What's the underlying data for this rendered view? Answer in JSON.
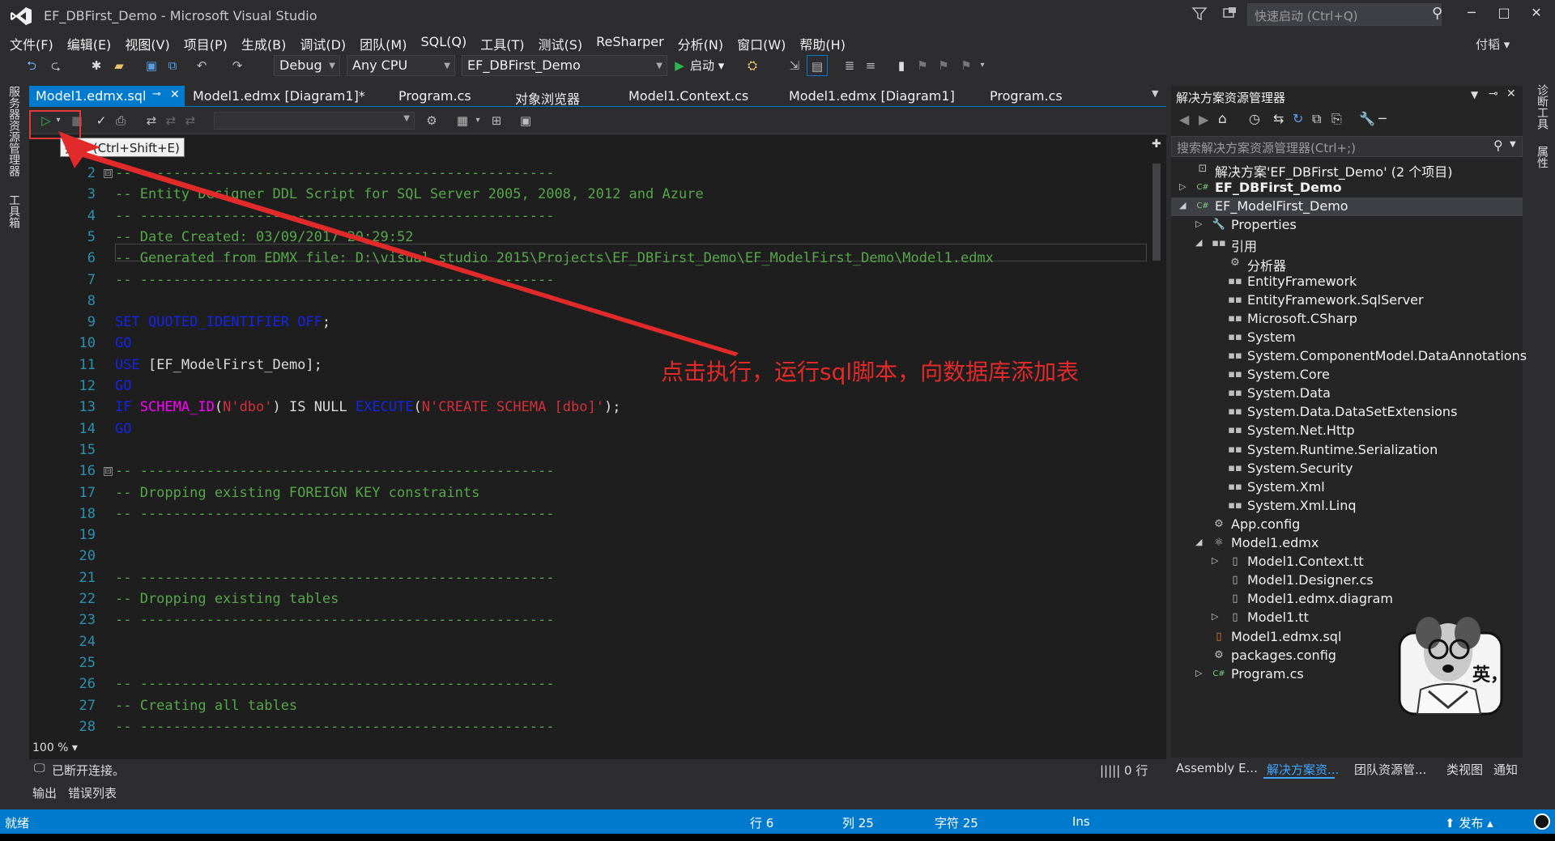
{
  "window": {
    "title": "EF_DBFirst_Demo - Microsoft Visual Studio",
    "quick_launch_placeholder": "快速启动 (Ctrl+Q)",
    "user": "付韬",
    "minimize": "─",
    "restore": "□",
    "close": "✕"
  },
  "menu": [
    "文件(F)",
    "编辑(E)",
    "视图(V)",
    "项目(P)",
    "生成(B)",
    "调试(D)",
    "团队(M)",
    "SQL(Q)",
    "工具(T)",
    "测试(S)",
    "ReSharper",
    "分析(N)",
    "窗口(W)",
    "帮助(H)"
  ],
  "toolbar": {
    "config": "Debug",
    "platform": "Any CPU",
    "project": "EF_DBFirst_Demo",
    "start_label": "启动"
  },
  "left_side_tabs": [
    "服务器资源管理器",
    "工具箱"
  ],
  "right_side_tabs": [
    "诊断工具",
    "属性"
  ],
  "tabs": [
    {
      "label": "Model1.edmx.sql",
      "pin": "⊸",
      "close": "✕"
    },
    {
      "label": "Model1.edmx [Diagram1]*"
    },
    {
      "label": "Program.cs"
    },
    {
      "label": "对象浏览器"
    },
    {
      "label": "Model1.Context.cs"
    },
    {
      "label": "Model1.edmx [Diagram1]"
    },
    {
      "label": "Program.cs"
    }
  ],
  "tooltip": "执行 (Ctrl+Shift+E)",
  "editor": {
    "lines": [
      {
        "n": "2",
        "fold": "⊟",
        "parts": [
          {
            "c": "cm",
            "t": "-- --------------------------------------------------"
          }
        ]
      },
      {
        "n": "3",
        "parts": [
          {
            "c": "cm",
            "t": "-- Entity Designer DDL Script for SQL Server 2005, 2008, 2012 and Azure"
          }
        ]
      },
      {
        "n": "4",
        "parts": [
          {
            "c": "cm",
            "t": "-- --------------------------------------------------"
          }
        ]
      },
      {
        "n": "5",
        "parts": [
          {
            "c": "cm",
            "t": "-- Date Created: 03/09/2017 20:29:52"
          }
        ]
      },
      {
        "n": "6",
        "parts": [
          {
            "c": "cm",
            "t": "-- Generated from EDMX file: D:\\visual studio 2015\\Projects\\EF_DBFirst_Demo\\EF_ModelFirst_Demo\\Model1.edmx"
          }
        ]
      },
      {
        "n": "7",
        "parts": [
          {
            "c": "cm",
            "t": "-- --------------------------------------------------"
          }
        ]
      },
      {
        "n": "8",
        "parts": []
      },
      {
        "n": "9",
        "parts": [
          {
            "c": "kw",
            "t": "SET QUOTED_IDENTIFIER OFF"
          },
          {
            "c": "tx",
            "t": ";"
          }
        ]
      },
      {
        "n": "10",
        "parts": [
          {
            "c": "kw",
            "t": "GO"
          }
        ]
      },
      {
        "n": "11",
        "parts": [
          {
            "c": "kw",
            "t": "USE "
          },
          {
            "c": "tx",
            "t": "[EF_ModelFirst_Demo];"
          }
        ]
      },
      {
        "n": "12",
        "parts": [
          {
            "c": "kw",
            "t": "GO"
          }
        ]
      },
      {
        "n": "13",
        "parts": [
          {
            "c": "kw",
            "t": "IF "
          },
          {
            "c": "fn",
            "t": "SCHEMA_ID"
          },
          {
            "c": "tx",
            "t": "("
          },
          {
            "c": "st",
            "t": "N'dbo'"
          },
          {
            "c": "tx",
            "t": ") IS NULL "
          },
          {
            "c": "kw",
            "t": "EXECUTE"
          },
          {
            "c": "tx",
            "t": "("
          },
          {
            "c": "st",
            "t": "N'CREATE SCHEMA [dbo]'"
          },
          {
            "c": "tx",
            "t": ");"
          }
        ]
      },
      {
        "n": "14",
        "parts": [
          {
            "c": "kw",
            "t": "GO"
          }
        ]
      },
      {
        "n": "15",
        "parts": []
      },
      {
        "n": "16",
        "fold": "⊟",
        "parts": [
          {
            "c": "cm",
            "t": "-- --------------------------------------------------"
          }
        ]
      },
      {
        "n": "17",
        "parts": [
          {
            "c": "cm",
            "t": "-- Dropping existing FOREIGN KEY constraints"
          }
        ]
      },
      {
        "n": "18",
        "parts": [
          {
            "c": "cm",
            "t": "-- --------------------------------------------------"
          }
        ]
      },
      {
        "n": "19",
        "parts": []
      },
      {
        "n": "20",
        "parts": []
      },
      {
        "n": "21",
        "parts": [
          {
            "c": "cm",
            "t": "-- --------------------------------------------------"
          }
        ]
      },
      {
        "n": "22",
        "parts": [
          {
            "c": "cm",
            "t": "-- Dropping existing tables"
          }
        ]
      },
      {
        "n": "23",
        "parts": [
          {
            "c": "cm",
            "t": "-- --------------------------------------------------"
          }
        ]
      },
      {
        "n": "24",
        "parts": []
      },
      {
        "n": "25",
        "parts": []
      },
      {
        "n": "26",
        "parts": [
          {
            "c": "cm",
            "t": "-- --------------------------------------------------"
          }
        ]
      },
      {
        "n": "27",
        "parts": [
          {
            "c": "cm",
            "t": "-- Creating all tables"
          }
        ]
      },
      {
        "n": "28",
        "parts": [
          {
            "c": "cm",
            "t": "-- --------------------------------------------------"
          }
        ]
      }
    ],
    "zoom": "100 %",
    "annotation": "点击执行，运行sql脚本，向数据库添加表",
    "connection_status": "已断开连接。",
    "row_count": "||||| 0 行"
  },
  "bottom_tabs": [
    "输出",
    "错误列表"
  ],
  "solution": {
    "title": "解决方案资源管理器",
    "search_placeholder": "搜索解决方案资源管理器(Ctrl+;)",
    "nodes": [
      {
        "label": "解决方案'EF_DBFirst_Demo' (2 个项目)",
        "level": 0,
        "icon": "solution-icon",
        "exp": ""
      },
      {
        "label": "EF_DBFirst_Demo",
        "level": 0,
        "icon": "csproj-icon",
        "exp": "▷",
        "bold": true
      },
      {
        "label": "EF_ModelFirst_Demo",
        "level": 0,
        "icon": "csproj-icon",
        "exp": "◢",
        "sel": true
      },
      {
        "label": "Properties",
        "level": 1,
        "icon": "wrench-icon",
        "exp": "▷"
      },
      {
        "label": "引用",
        "level": 1,
        "icon": "reference-icon",
        "exp": "◢"
      },
      {
        "label": "分析器",
        "level": 2,
        "icon": "analyzer-icon",
        "exp": ""
      },
      {
        "label": "EntityFramework",
        "level": 2,
        "icon": "reference-icon",
        "exp": ""
      },
      {
        "label": "EntityFramework.SqlServer",
        "level": 2,
        "icon": "reference-icon",
        "exp": ""
      },
      {
        "label": "Microsoft.CSharp",
        "level": 2,
        "icon": "reference-icon",
        "exp": ""
      },
      {
        "label": "System",
        "level": 2,
        "icon": "reference-icon",
        "exp": ""
      },
      {
        "label": "System.ComponentModel.DataAnnotations",
        "level": 2,
        "icon": "reference-icon",
        "exp": ""
      },
      {
        "label": "System.Core",
        "level": 2,
        "icon": "reference-icon",
        "exp": ""
      },
      {
        "label": "System.Data",
        "level": 2,
        "icon": "reference-icon",
        "exp": ""
      },
      {
        "label": "System.Data.DataSetExtensions",
        "level": 2,
        "icon": "reference-icon",
        "exp": ""
      },
      {
        "label": "System.Net.Http",
        "level": 2,
        "icon": "reference-icon",
        "exp": ""
      },
      {
        "label": "System.Runtime.Serialization",
        "level": 2,
        "icon": "reference-icon",
        "exp": ""
      },
      {
        "label": "System.Security",
        "level": 2,
        "icon": "reference-icon",
        "exp": ""
      },
      {
        "label": "System.Xml",
        "level": 2,
        "icon": "reference-icon",
        "exp": ""
      },
      {
        "label": "System.Xml.Linq",
        "level": 2,
        "icon": "reference-icon",
        "exp": ""
      },
      {
        "label": "App.config",
        "level": 1,
        "icon": "config-icon",
        "exp": ""
      },
      {
        "label": "Model1.edmx",
        "level": 1,
        "icon": "edmx-icon",
        "exp": "◢"
      },
      {
        "label": "Model1.Context.tt",
        "level": 2,
        "icon": "file-icon",
        "exp": "▷"
      },
      {
        "label": "Model1.Designer.cs",
        "level": 2,
        "icon": "file-icon",
        "exp": ""
      },
      {
        "label": "Model1.edmx.diagram",
        "level": 2,
        "icon": "file-icon",
        "exp": ""
      },
      {
        "label": "Model1.tt",
        "level": 2,
        "icon": "file-icon",
        "exp": "▷"
      },
      {
        "label": "Model1.edmx.sql",
        "level": 1,
        "icon": "sql-file-icon",
        "exp": ""
      },
      {
        "label": "packages.config",
        "level": 1,
        "icon": "config-icon",
        "exp": ""
      },
      {
        "label": "Program.cs",
        "level": 1,
        "icon": "csharp-file-icon",
        "exp": "▷"
      }
    ],
    "bottom_tabs": [
      "Assembly E...",
      "解决方案资...",
      "团队资源管...",
      "类视图",
      "通知"
    ],
    "mascot_text": "英，"
  },
  "statusbar": {
    "ready": "就绪",
    "row": "行 6",
    "col": "列 25",
    "char": "字符 25",
    "ins": "Ins",
    "publish": "发布"
  },
  "colors": {
    "accent": "#007acc",
    "annotation": "#e32a2a",
    "comment": "#57a64a",
    "keyword": "#1524e6"
  }
}
